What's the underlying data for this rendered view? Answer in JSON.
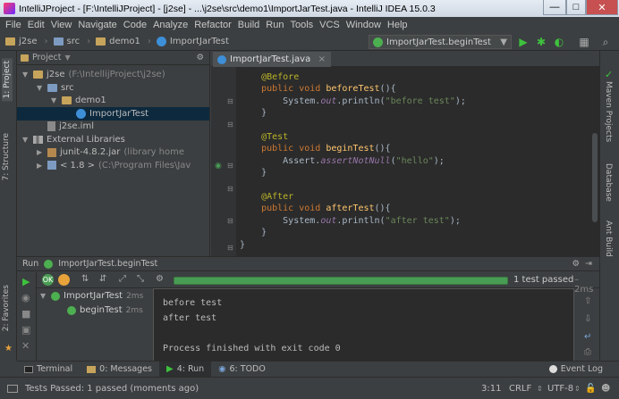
{
  "window": {
    "title": "IntelliJProject - [F:\\IntelliJProject] - [j2se] - ...\\j2se\\src\\demo1\\ImportJarTest.java - IntelliJ IDEA 15.0.3",
    "minimize": "—",
    "maximize": "□",
    "close": "✕"
  },
  "menu": [
    "File",
    "Edit",
    "View",
    "Navigate",
    "Code",
    "Analyze",
    "Refactor",
    "Build",
    "Run",
    "Tools",
    "VCS",
    "Window",
    "Help"
  ],
  "breadcrumbs": [
    "j2se",
    "src",
    "demo1",
    "ImportJarTest"
  ],
  "toolbar": {
    "run_config": "ImportJarTest.beginTest"
  },
  "left_tabs": {
    "project": "1: Project",
    "structure": "7: Structure",
    "favorites": "2: Favorites"
  },
  "project": {
    "selector": "Project",
    "tree": [
      {
        "label": "j2se",
        "extra": "(F:\\IntellijProject\\j2se)",
        "icon": "module-folder-icon",
        "indent": 0,
        "expanded": true
      },
      {
        "label": "src",
        "extra": "",
        "icon": "src-folder-icon",
        "indent": 1,
        "expanded": true
      },
      {
        "label": "demo1",
        "extra": "",
        "icon": "package-icon",
        "indent": 2,
        "expanded": true
      },
      {
        "label": "ImportJarTest",
        "extra": "",
        "icon": "java-class-icon",
        "indent": 3,
        "expanded": null,
        "selected": true
      },
      {
        "label": "j2se.iml",
        "extra": "",
        "icon": "iml-file-icon",
        "indent": 1,
        "expanded": null
      },
      {
        "label": "External Libraries",
        "extra": "",
        "icon": "library-icon",
        "indent": 0,
        "expanded": true
      },
      {
        "label": "junit-4.8.2.jar",
        "extra": "(library home",
        "icon": "jar-icon",
        "indent": 1,
        "expanded": false
      },
      {
        "label": "< 1.8 >",
        "extra": "(C:\\Program Files\\Jav",
        "icon": "jdk-icon",
        "indent": 1,
        "expanded": false
      }
    ]
  },
  "editor": {
    "tab": "ImportJarTest.java",
    "lines": [
      [
        {
          "t": "    @Before",
          "c": "ann"
        }
      ],
      [
        {
          "t": "    public void ",
          "c": "kw"
        },
        {
          "t": "beforeTest",
          "c": "fn"
        },
        {
          "t": "(){",
          "c": ""
        }
      ],
      [
        {
          "t": "        System.",
          "c": ""
        },
        {
          "t": "out",
          "c": "it"
        },
        {
          "t": ".println(",
          "c": ""
        },
        {
          "t": "\"before test\"",
          "c": "st"
        },
        {
          "t": ");",
          "c": ""
        }
      ],
      [
        {
          "t": "    }",
          "c": ""
        }
      ],
      [
        {
          "t": "",
          "c": ""
        }
      ],
      [
        {
          "t": "    @Test",
          "c": "ann"
        }
      ],
      [
        {
          "t": "    public void ",
          "c": "kw"
        },
        {
          "t": "beginTest",
          "c": "fn"
        },
        {
          "t": "(){",
          "c": ""
        }
      ],
      [
        {
          "t": "        Assert.",
          "c": ""
        },
        {
          "t": "assertNotNull",
          "c": "it"
        },
        {
          "t": "(",
          "c": ""
        },
        {
          "t": "\"hello\"",
          "c": "st"
        },
        {
          "t": ");",
          "c": ""
        }
      ],
      [
        {
          "t": "    }",
          "c": ""
        }
      ],
      [
        {
          "t": "",
          "c": ""
        }
      ],
      [
        {
          "t": "    @After",
          "c": "ann"
        }
      ],
      [
        {
          "t": "    public void ",
          "c": "kw"
        },
        {
          "t": "afterTest",
          "c": "fn"
        },
        {
          "t": "(){",
          "c": ""
        }
      ],
      [
        {
          "t": "        System.",
          "c": ""
        },
        {
          "t": "out",
          "c": "it"
        },
        {
          "t": ".println(",
          "c": ""
        },
        {
          "t": "\"after test\"",
          "c": "st"
        },
        {
          "t": ");",
          "c": ""
        }
      ],
      [
        {
          "t": "    }",
          "c": ""
        }
      ],
      [
        {
          "t": "}",
          "c": ""
        }
      ]
    ]
  },
  "right_tabs": {
    "maven": "Maven Projects",
    "database": "Database",
    "ant": "Ant Build"
  },
  "run": {
    "label": "Run",
    "config": "ImportJarTest.beginTest",
    "progress": 1.0,
    "summary": "1 test passed",
    "summary_time": "– 2ms",
    "tree": [
      {
        "label": "ImportJarTest",
        "time": "2ms"
      },
      {
        "label": "beginTest",
        "time": "2ms"
      }
    ],
    "console": [
      "before test",
      "after test",
      "",
      "Process finished with exit code 0"
    ]
  },
  "bottom_tabs": [
    "Terminal",
    "0: Messages",
    "4: Run",
    "6: TODO"
  ],
  "event_log": "Event Log",
  "status": {
    "message": "Tests Passed: 1 passed (moments ago)",
    "position": "3:11",
    "line_sep": "CRLF",
    "encoding": "UTF-8"
  },
  "colors": {
    "pass": "#499c54",
    "accent": "#3d8fd8",
    "run_green": "#3ec23e"
  }
}
